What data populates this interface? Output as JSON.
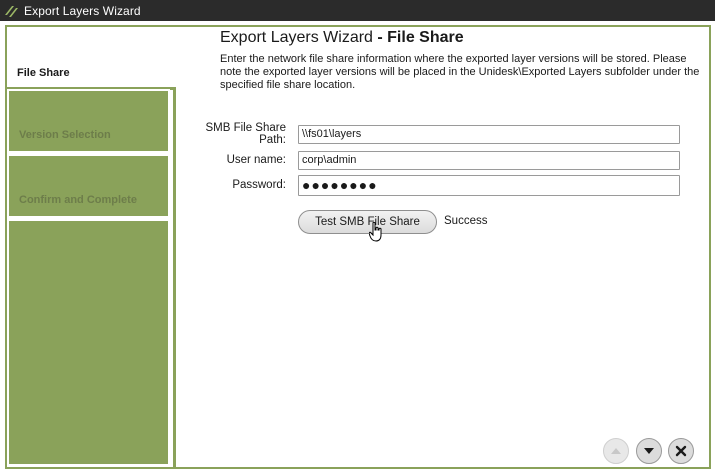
{
  "window": {
    "title": "Export Layers Wizard"
  },
  "steps": [
    {
      "label": "File Share",
      "state": "active"
    },
    {
      "label": "Version Selection",
      "state": "inactive"
    },
    {
      "label": "Confirm and Complete",
      "state": "inactive"
    }
  ],
  "page": {
    "heading_prefix": "Export Layers Wizard",
    "heading_suffix": " - File Share",
    "description": "Enter the network file share information where the exported layer versions will be stored.  Please note the exported layer versions will be placed in the Unidesk\\Exported Layers subfolder under the specified file share location."
  },
  "form": {
    "path_label": "SMB File Share Path:",
    "path_value": "\\\\fs01\\layers",
    "user_label": "User name:",
    "user_value": "corp\\admin",
    "password_label": "Password:",
    "password_value": "●●●●●●●●"
  },
  "test": {
    "button_label": "Test SMB File Share",
    "status": "Success"
  },
  "nav": {
    "prev_icon": "chevron-up-icon",
    "next_icon": "chevron-down-icon",
    "close_icon": "close-icon"
  },
  "colors": {
    "accent": "#8aa25a",
    "titlebar": "#2b2b2b"
  }
}
